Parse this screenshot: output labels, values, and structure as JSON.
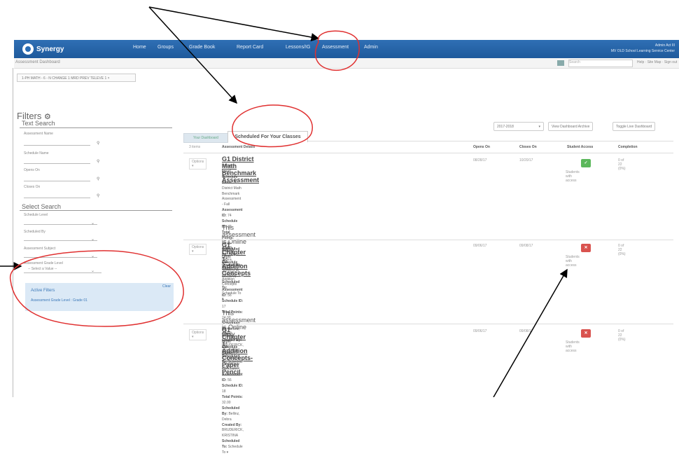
{
  "navbar": {
    "logo_text": "Synergy",
    "items": [
      "Home",
      "Groups",
      "Grade Book",
      "Report Card",
      "Lessons/IG",
      "Assessment",
      "Admin"
    ],
    "user_name": "Admin Act III",
    "user_sub": "MV OLD School Learning Service Center"
  },
  "subbar": {
    "breadcrumb": "Assessment Dashboard",
    "search_placeholder": "Search",
    "links": "Help · Site Map · Sign out"
  },
  "doc_tab": "1-PH MATH - 6 - N CHANGE 1 MRD PREV TELEVE 1 ×",
  "filters": {
    "title": "Filters",
    "text_search_title": "Text Search",
    "text_fields": [
      {
        "label": "Assessment Name"
      },
      {
        "label": "Schedule Name"
      },
      {
        "label": "Opens On"
      },
      {
        "label": "Closes On"
      }
    ],
    "select_search_title": "Select Search",
    "select_fields": [
      {
        "label": "Schedule Level",
        "value": ""
      },
      {
        "label": "Scheduled By",
        "value": ""
      },
      {
        "label": "Assessment Subject",
        "value": ""
      },
      {
        "label": "Assessment Grade Level",
        "value": "-- Select a Value --"
      }
    ],
    "active": {
      "title": "Active Filters",
      "value": "Assessment Grade Level : Grade 01",
      "clear": "Clear"
    }
  },
  "controls": {
    "year": "2017-2018",
    "archive": "View Dashboard Archive",
    "toggle": "Toggle Live Dashboard"
  },
  "tabs": {
    "tab1": "Your Dashboard",
    "tab2": "Scheduled For Your Classes"
  },
  "item_count": "3 items",
  "columns": {
    "details": "Assessment Details",
    "opens": "Opens On",
    "closes": "Closes On",
    "access": "Student Access",
    "completion": "Completion"
  },
  "rows": [
    {
      "options": "Options ▾",
      "title": "G1 District Math Benchmark Assessment",
      "level": "District Level",
      "schedule_name": "G1 District Math Benchmark Assessment - Fall",
      "assessment_id": "74",
      "schedule_id": "32",
      "total_points": "32.00",
      "scheduled_by": "Bellinz, Debra",
      "created_by": "JOHNSON, NATHAN",
      "scheduled_to": "Schedule To ▾",
      "online_note": "This assessment is Online Only",
      "opens": "08/28/17",
      "closes": "10/20/17",
      "access_symbol": "✓",
      "access_color": "#5cb85c",
      "access_text": "Students with access",
      "completion": "0 of 22 (0%)"
    },
    {
      "options": "Options ▾",
      "title": "G1 Chapter 1: Addition Concepts",
      "level": "District Level",
      "schedule_name": "G1 Chapter 1: Addition Concepts",
      "assessment_id": "56",
      "schedule_id": "17",
      "total_points": "24.00",
      "scheduled_by": "Bellinz, Debra",
      "created_by": "BRUDERICK, KRISTINA",
      "scheduled_to": "Schedule To ▾",
      "online_note": "This assessment is Online Only",
      "opens": "09/06/17",
      "closes": "09/08/17",
      "access_symbol": "✕",
      "access_color": "#d9534f",
      "access_text": "Students with access",
      "completion": "0 of 22 (0%)"
    },
    {
      "options": "Options ▾",
      "title": "G1 Chapter 1: Addition Concepts- Paper Pencil",
      "level": "District Level",
      "schedule_name": "PP G1 Chapter 1: Addition Concepts",
      "assessment_id": "56",
      "schedule_id": "18",
      "total_points": "32.00",
      "scheduled_by": "Bellinz, Debra",
      "created_by": "BRUDERICK, KRISTINA",
      "scheduled_to": "Schedule To ▾",
      "opens": "09/06/17",
      "closes": "09/08/17",
      "access_symbol": "✕",
      "access_color": "#d9534f",
      "access_text": "Students with access",
      "completion": "0 of 22 (0%)"
    }
  ],
  "labels": {
    "schedule_name": "Schedule Name:",
    "assessment_id": "Assessment ID:",
    "schedule_id": "Schedule ID:",
    "total_points": "Total Points:",
    "scheduled_by": "Scheduled By:",
    "created_by": "Created By:",
    "scheduled_to": "Scheduled To:"
  }
}
